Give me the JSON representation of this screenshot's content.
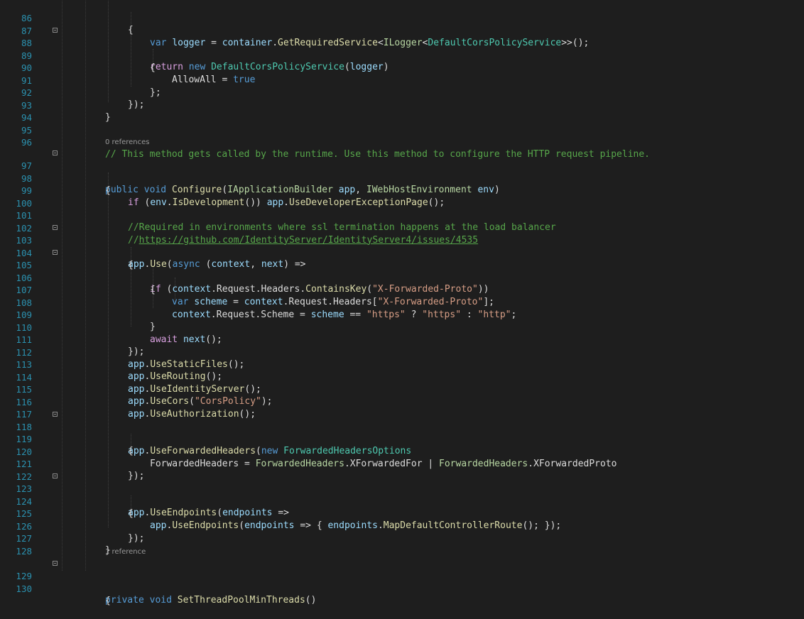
{
  "editor": {
    "language": "C#",
    "lines": [
      {
        "n": "86",
        "y": 0
      },
      {
        "n": "87"
      },
      {
        "n": "88"
      },
      {
        "n": "89"
      },
      {
        "n": "90"
      },
      {
        "n": "91"
      },
      {
        "n": "92"
      },
      {
        "n": "93"
      },
      {
        "n": "94"
      },
      {
        "n": "95"
      },
      {
        "n": "96"
      },
      {
        "n": "97"
      },
      {
        "n": "98"
      },
      {
        "n": "99"
      },
      {
        "n": "100"
      },
      {
        "n": "101"
      },
      {
        "n": "102"
      },
      {
        "n": "103"
      },
      {
        "n": "104"
      },
      {
        "n": "105"
      },
      {
        "n": "106"
      },
      {
        "n": "107"
      },
      {
        "n": "108"
      },
      {
        "n": "109"
      },
      {
        "n": "110"
      },
      {
        "n": "111"
      },
      {
        "n": "112"
      },
      {
        "n": "113"
      },
      {
        "n": "114"
      },
      {
        "n": "115"
      },
      {
        "n": "116"
      },
      {
        "n": "117"
      },
      {
        "n": "118"
      },
      {
        "n": "119"
      },
      {
        "n": "120"
      },
      {
        "n": "121"
      },
      {
        "n": "122"
      },
      {
        "n": "123"
      },
      {
        "n": "124"
      },
      {
        "n": "125"
      },
      {
        "n": "126"
      },
      {
        "n": "127"
      },
      {
        "n": "128"
      },
      {
        "n": "129"
      },
      {
        "n": "130"
      }
    ],
    "codelens": {
      "configure": "0 references",
      "setThreadPool": "1 reference"
    },
    "code": {
      "l86_brace": "{",
      "l87_var": "var",
      "l87_logger": "logger",
      "l87_eq": " = ",
      "l87_container": "container",
      "l87_dot": ".",
      "l87_get": "GetRequiredService",
      "l87_lt": "<",
      "l87_ilogger": "ILogger",
      "l87_lt2": "<",
      "l87_type": "DefaultCorsPolicyService",
      "l87_end": ">>();",
      "l88_return": "return",
      "l88_new": "new",
      "l88_type": "DefaultCorsPolicyService",
      "l88_open": "(",
      "l88_logger": "logger",
      "l88_close": ")",
      "l89_brace": "{",
      "l90_allow": "AllowAll",
      "l90_eq": " = ",
      "l90_true": "true",
      "l91_close": "};",
      "l92_close": "});",
      "l93_close": "}",
      "l96_comment": "// This method gets called by the runtime. Use this method to configure the HTTP request pipeline.",
      "l97_public": "public",
      "l97_void": "void",
      "l97_configure": "Configure",
      "l97_open": "(",
      "l97_iapp": "IApplicationBuilder",
      "l97_app": "app",
      "l97_comma": ", ",
      "l97_ienv": "IWebHostEnvironment",
      "l97_env": "env",
      "l97_close": ")",
      "l98_brace": "{",
      "l99_if": "if",
      "l99_open": " (",
      "l99_env": "env",
      "l99_dot": ".",
      "l99_isdev": "IsDevelopment",
      "l99_mid": "()) ",
      "l99_app": "app",
      "l99_dot2": ".",
      "l99_use": "UseDeveloperExceptionPage",
      "l99_end": "();",
      "l101_comment": "//Required in environments where ssl termination happens at the load balancer",
      "l102_slashes": "//",
      "l102_link": "https://github.com/IdentityServer/IdentityServer4/issues/4535",
      "l103_app": "app",
      "l103_dot": ".",
      "l103_use": "Use",
      "l103_open": "(",
      "l103_async": "async",
      "l103_args_open": " (",
      "l103_context": "context",
      "l103_comma": ", ",
      "l103_next": "next",
      "l103_arrow": ") =>",
      "l104_brace": "{",
      "l105_if": "if",
      "l105_open": " (",
      "l105_context": "context",
      "l105_req": ".Request.Headers.",
      "l105_contains": "ContainsKey",
      "l105_popen": "(",
      "l105_str": "\"X-Forwarded-Proto\"",
      "l105_close": "))",
      "l106_brace": "{",
      "l107_var": "var",
      "l107_scheme": "scheme",
      "l107_eq": " = ",
      "l107_context": "context",
      "l107_req": ".Request.Headers[",
      "l107_str": "\"X-Forwarded-Proto\"",
      "l107_end": "];",
      "l108_context": "context",
      "l108_req": ".Request.Scheme = ",
      "l108_scheme": "scheme",
      "l108_eqeq": " == ",
      "l108_https1": "\"https\"",
      "l108_q": " ? ",
      "l108_https2": "\"https\"",
      "l108_colon": " : ",
      "l108_http": "\"http\"",
      "l108_end": ";",
      "l109_brace": "}",
      "l110_await": "await",
      "l110_next": "next",
      "l110_end": "();",
      "l111_close": "});",
      "l112_app": "app",
      "l112_fn": "UseStaticFiles",
      "l113_app": "app",
      "l113_fn": "UseRouting",
      "l114_app": "app",
      "l114_fn": "UseIdentityServer",
      "l115_app": "app",
      "l115_fn": "UseCors",
      "l115_str": "\"CorsPolicy\"",
      "l116_app": "app",
      "l116_fn": "UseAuthorization",
      "call_end": "();",
      "dot": ".",
      "l118_app": "app",
      "l118_fn": "UseForwardedHeaders",
      "l118_open": "(",
      "l118_new": "new",
      "l118_type": "ForwardedHeadersOptions",
      "l119_brace": "{",
      "l120_prop": "ForwardedHeaders",
      "l120_eq": " = ",
      "l120_enum1": "ForwardedHeaders",
      "l120_val1": ".XForwardedFor | ",
      "l120_enum2": "ForwardedHeaders",
      "l120_val2": ".XForwardedProto",
      "l121_close": "});",
      "l123_app": "app",
      "l123_fn": "UseEndpoints",
      "l123_open": "(",
      "l123_endpoints": "endpoints",
      "l123_arrow": " =>",
      "l124_brace": "{",
      "l125_app": "app",
      "l125_fn": "UseEndpoints",
      "l125_open": "(",
      "l125_endpoints": "endpoints",
      "l125_arrow": " => { ",
      "l125_endpoints2": "endpoints",
      "l125_map": "MapDefaultControllerRoute",
      "l125_end": "(); });",
      "l126_close": "});",
      "l127_close": "}",
      "l129_private": "private",
      "l129_void": "void",
      "l129_name": "SetThreadPoolMinThreads",
      "l129_end": "()",
      "l130_brace": "{"
    }
  }
}
